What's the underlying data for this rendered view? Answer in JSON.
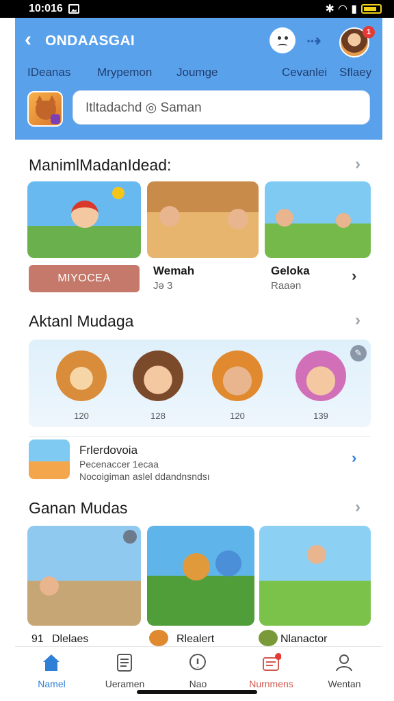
{
  "status_bar": {
    "time": "10:016"
  },
  "header": {
    "title": "ONDAASGAI",
    "notification_count": "1",
    "nav": [
      "IDeanas",
      "Mrypemon",
      "Joumge",
      "Cevanlei",
      "Sflaey"
    ],
    "search_placeholder": "Itltadachd ◎ Saman"
  },
  "section1": {
    "title": "ManimlMadanIdead:",
    "pill_label": "MIYOCEA",
    "tiles": [
      {
        "name": "Wemah",
        "sub": "Jə 3"
      },
      {
        "name": "Geloka",
        "sub": "Raaən"
      }
    ]
  },
  "section2": {
    "title": "Aktanl Mudaga",
    "avatars": [
      {
        "label": "120"
      },
      {
        "label": "128"
      },
      {
        "label": "120"
      },
      {
        "label": "139"
      }
    ],
    "friend": {
      "title": "Frlerdovoia",
      "sub1": "Pecenaccer 1ecaa",
      "sub2": "Nocoigiman aslel ddandnsndsı"
    }
  },
  "section3": {
    "title": "Ganan Mudas",
    "items": [
      {
        "prefix": "91",
        "name": "Dlelaes"
      },
      {
        "name": "Rlealert"
      },
      {
        "name": "Nlanactor"
      }
    ]
  },
  "tabbar": [
    {
      "label": "Namel",
      "icon": "home-icon"
    },
    {
      "label": "Ueramen",
      "icon": "list-icon"
    },
    {
      "label": "Nao",
      "icon": "alert-icon"
    },
    {
      "label": "Nurnmens",
      "icon": "inbox-icon"
    },
    {
      "label": "Wentan",
      "icon": "person-icon"
    }
  ],
  "colors": {
    "header_blue": "#5aa1ec",
    "accent": "#2f7fd6",
    "pill": "#c5796a"
  }
}
